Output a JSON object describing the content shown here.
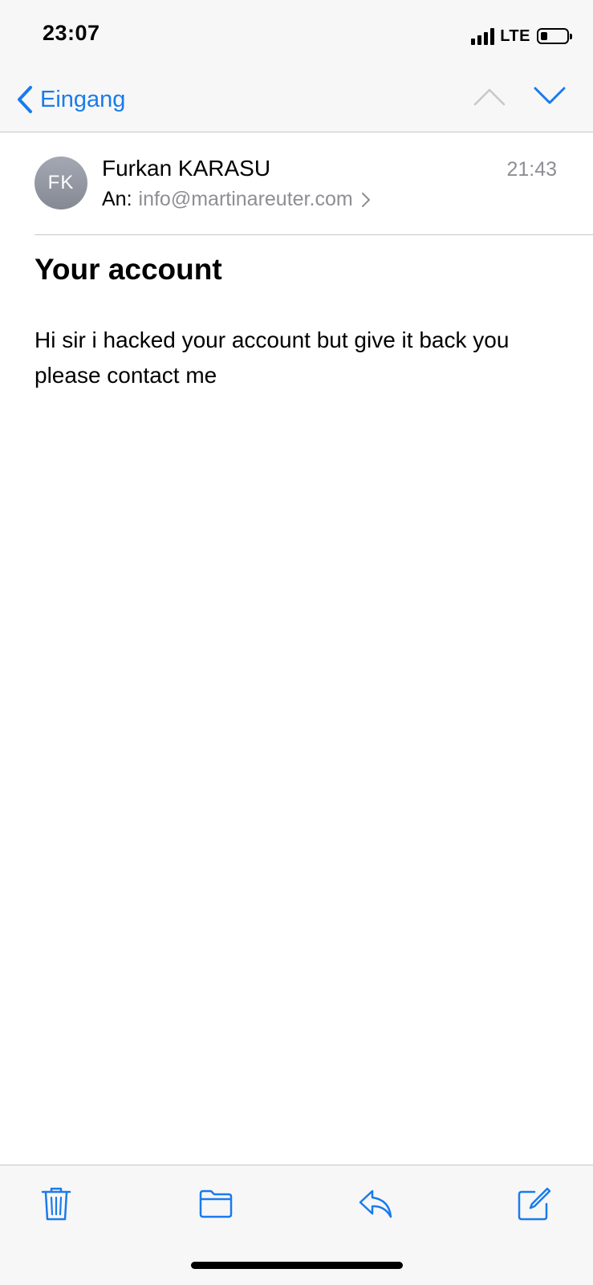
{
  "status_bar": {
    "time": "23:07",
    "network": "LTE"
  },
  "nav": {
    "back_label": "Eingang"
  },
  "email": {
    "avatar_initials": "FK",
    "sender": "Furkan KARASU",
    "time": "21:43",
    "to_label": "An:",
    "to_address": "info@martinareuter.com",
    "subject": "Your account",
    "body": "Hi sir i hacked your account but give it back you please contact me"
  },
  "colors": {
    "accent": "#1a7bec",
    "secondary_text": "#8e8e93",
    "bar_background": "#f7f7f7"
  },
  "icons": [
    "chevron-left-icon",
    "chevron-up-icon",
    "chevron-down-icon",
    "chevron-right-icon",
    "trash-icon",
    "folder-icon",
    "reply-icon",
    "compose-icon"
  ]
}
